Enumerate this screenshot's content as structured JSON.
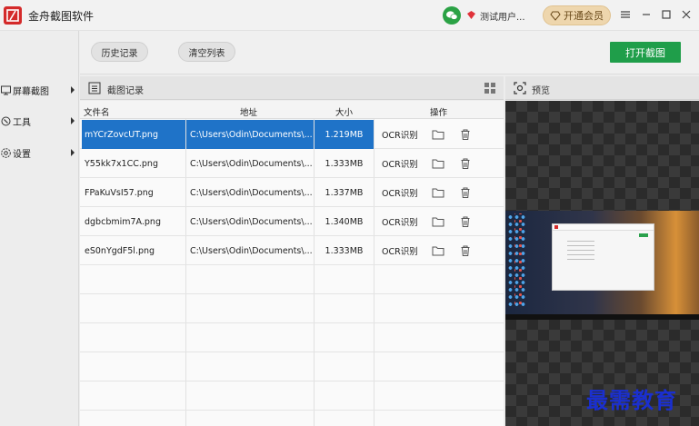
{
  "window": {
    "title": "金舟截图软件",
    "user_name": "测试用户...",
    "vip_label": "开通会员"
  },
  "sidebar": {
    "items": [
      {
        "label": "屏幕截图",
        "icon": "screen-capture-icon"
      },
      {
        "label": "工具",
        "icon": "tools-icon"
      },
      {
        "label": "设置",
        "icon": "gear-icon"
      }
    ]
  },
  "toolbar": {
    "history_label": "历史记录",
    "clear_label": "清空列表",
    "open_capture_label": "打开截图"
  },
  "records": {
    "title": "截图记录",
    "columns": [
      "文件名",
      "地址",
      "大小",
      "操作"
    ],
    "rows": [
      {
        "name": "mYCrZovcUT.png",
        "path": "C:\\Users\\Odin\\Documents\\...",
        "size": "1.219MB",
        "ocr": "OCR识别",
        "selected": true
      },
      {
        "name": "Y55kk7x1CC.png",
        "path": "C:\\Users\\Odin\\Documents\\...",
        "size": "1.333MB",
        "ocr": "OCR识别",
        "selected": false
      },
      {
        "name": "FPaKuVsI57.png",
        "path": "C:\\Users\\Odin\\Documents\\...",
        "size": "1.337MB",
        "ocr": "OCR识别",
        "selected": false
      },
      {
        "name": "dgbcbmim7A.png",
        "path": "C:\\Users\\Odin\\Documents\\...",
        "size": "1.340MB",
        "ocr": "OCR识别",
        "selected": false
      },
      {
        "name": "eS0nYgdF5l.png",
        "path": "C:\\Users\\Odin\\Documents\\...",
        "size": "1.333MB",
        "ocr": "OCR识别",
        "selected": false
      }
    ]
  },
  "preview": {
    "title": "预览"
  },
  "watermark": "最需教育",
  "colors": {
    "accent_green": "#1f9e4a",
    "selection_blue": "#1f73c8",
    "logo_red": "#d42a2a",
    "vip_gold": "#eed6ad",
    "watermark_blue": "#1a2fd0"
  }
}
